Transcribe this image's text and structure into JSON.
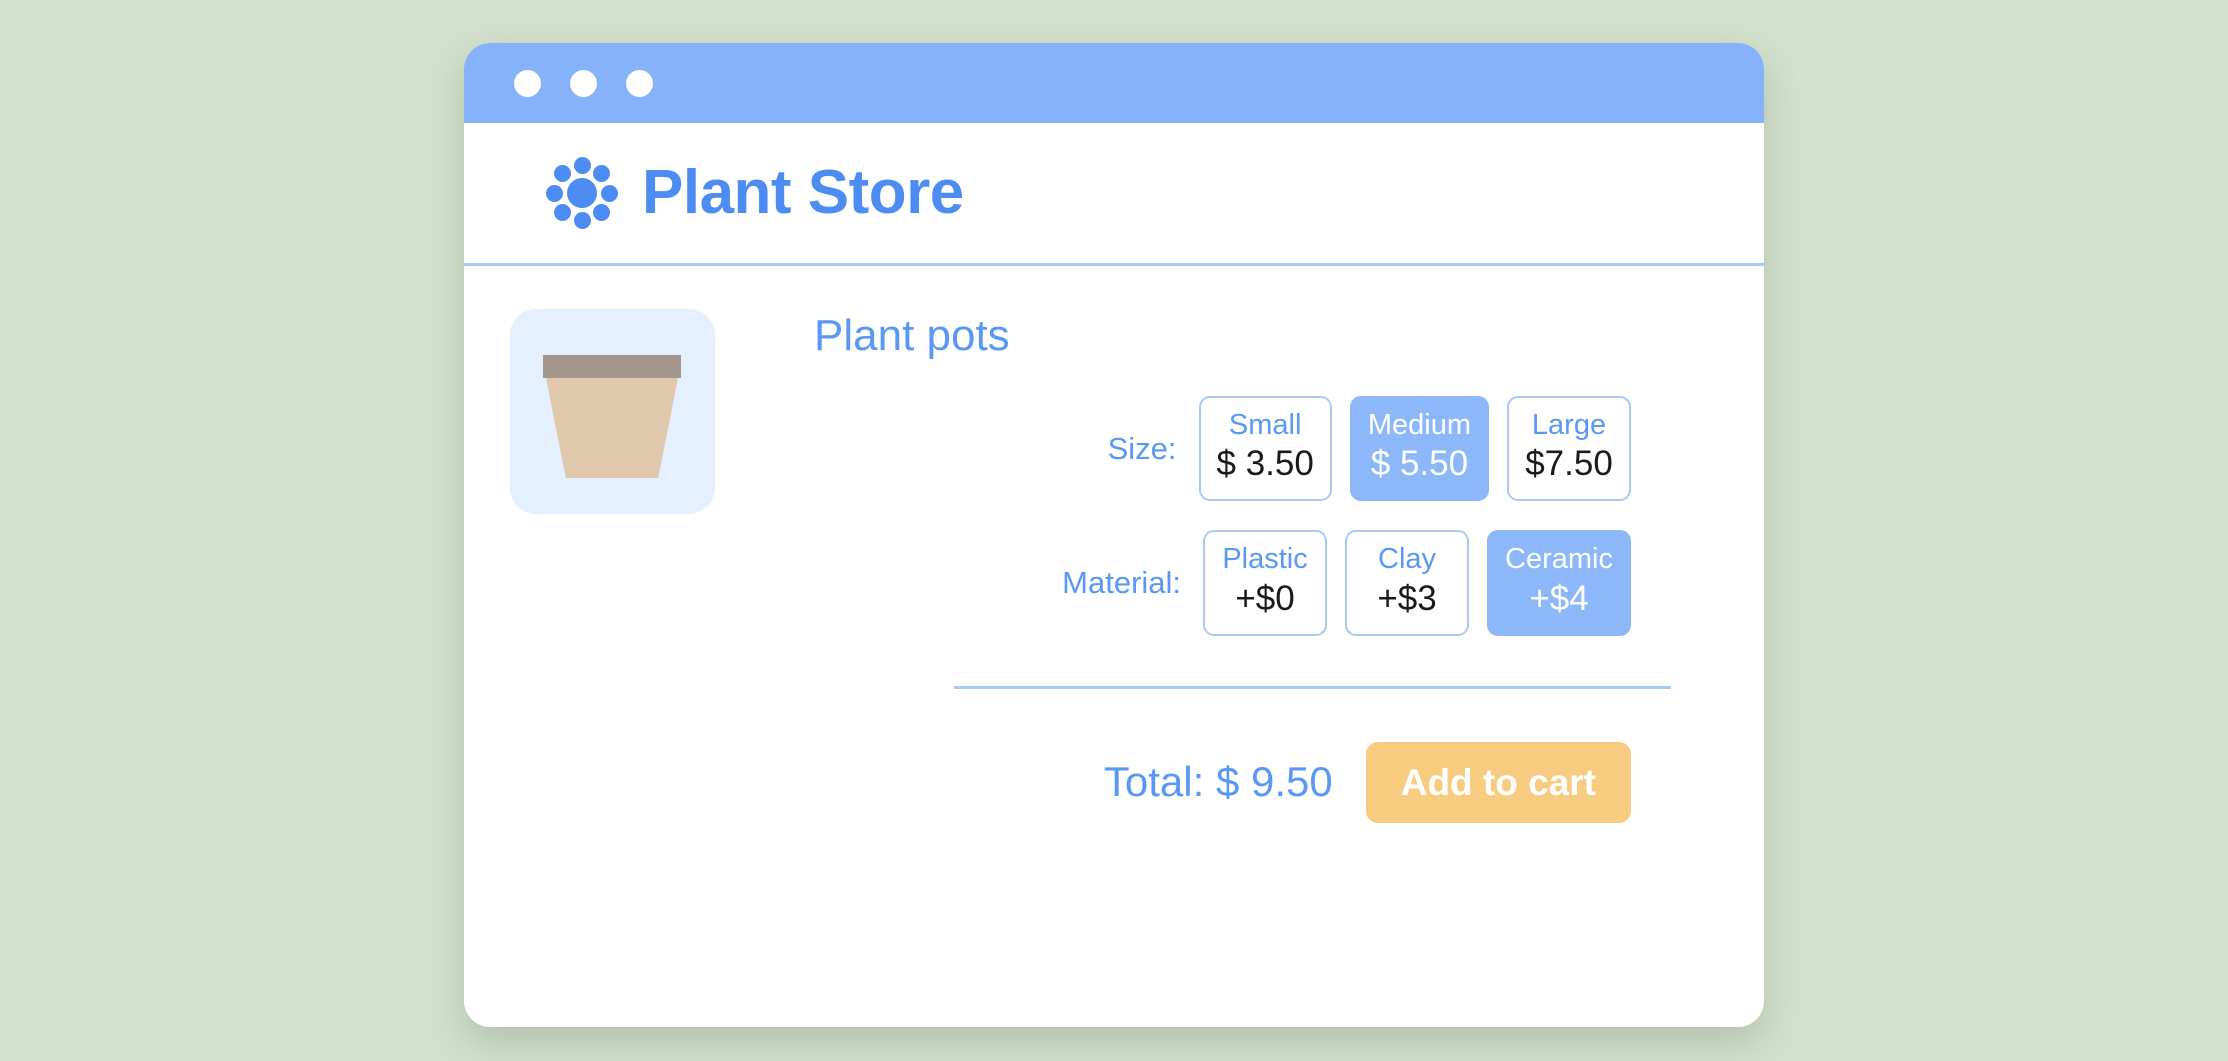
{
  "window": {
    "dots": [
      "close-dot",
      "minimize-dot",
      "maximize-dot"
    ],
    "titlebar_color": "#86b2fb"
  },
  "header": {
    "brand_title": "Plant Store",
    "logo_icon": "flower-logo-icon",
    "accent_color": "#4d8df3"
  },
  "product": {
    "title": "Plant pots",
    "image_icon": "plant-pot-icon",
    "image_background": "#e4f0fd",
    "pot_rim_color": "#a3958a",
    "pot_body_color": "#e0c8ac"
  },
  "options": {
    "size": {
      "label": "Size:",
      "choices": [
        {
          "name": "Small",
          "price": "$ 3.50",
          "selected": false
        },
        {
          "name": "Medium",
          "price": "$ 5.50",
          "selected": true
        },
        {
          "name": "Large",
          "price": "$7.50",
          "selected": false
        }
      ]
    },
    "material": {
      "label": "Material:",
      "choices": [
        {
          "name": "Plastic",
          "price": "+$0",
          "selected": false
        },
        {
          "name": "Clay",
          "price": "+$3",
          "selected": false
        },
        {
          "name": "Ceramic",
          "price": "+$4",
          "selected": true
        }
      ]
    }
  },
  "summary": {
    "total_label": "Total: $ 9.50",
    "add_to_cart_label": "Add to cart",
    "button_color": "#f8cc80"
  }
}
